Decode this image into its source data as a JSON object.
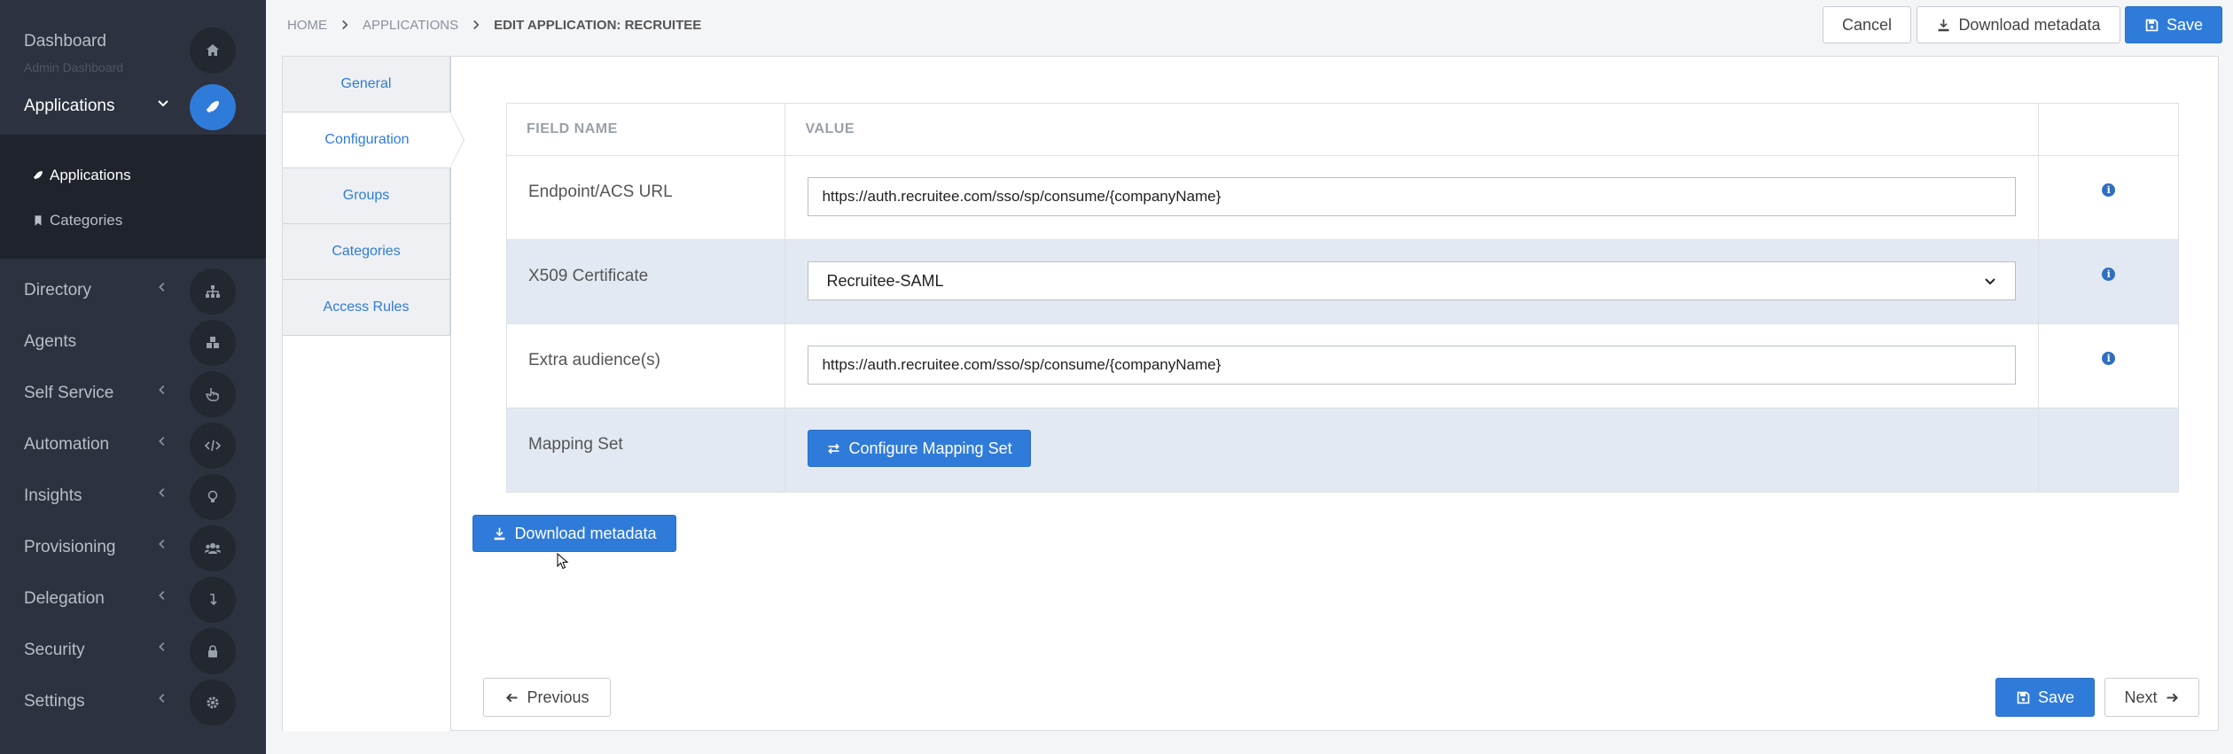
{
  "sidebar": {
    "dashboard": {
      "label": "Dashboard",
      "sub": "Admin Dashboard"
    },
    "applications": {
      "label": "Applications"
    },
    "submenu": [
      {
        "label": "Applications"
      },
      {
        "label": "Categories"
      }
    ],
    "items": [
      {
        "label": "Directory"
      },
      {
        "label": "Agents"
      },
      {
        "label": "Self Service"
      },
      {
        "label": "Automation"
      },
      {
        "label": "Insights"
      },
      {
        "label": "Provisioning"
      },
      {
        "label": "Delegation"
      },
      {
        "label": "Security"
      },
      {
        "label": "Settings"
      }
    ]
  },
  "breadcrumb": {
    "home": "HOME",
    "applications": "APPLICATIONS",
    "current": "EDIT APPLICATION: RECRUITEE"
  },
  "toolbar": {
    "cancel": "Cancel",
    "download": "Download metadata",
    "save": "Save"
  },
  "tabs": [
    {
      "label": "General"
    },
    {
      "label": "Configuration"
    },
    {
      "label": "Groups"
    },
    {
      "label": "Categories"
    },
    {
      "label": "Access Rules"
    }
  ],
  "table": {
    "headers": {
      "field": "FIELD NAME",
      "value": "VALUE"
    },
    "rows": [
      {
        "field": "Endpoint/ACS URL",
        "value": "https://auth.recruitee.com/sso/sp/consume/{companyName}"
      },
      {
        "field": "X509 Certificate",
        "value": "Recruitee-SAML"
      },
      {
        "field": "Extra audience(s)",
        "value": "https://auth.recruitee.com/sso/sp/consume/{companyName}"
      },
      {
        "field": "Mapping Set",
        "value": "Configure Mapping Set"
      }
    ]
  },
  "actions": {
    "download": "Download metadata",
    "previous": "Previous",
    "save": "Save",
    "next": "Next"
  },
  "colors": {
    "accent": "#2f7bd9",
    "sidebar": "#2c323f",
    "row_shaded": "#e3e9f2"
  }
}
